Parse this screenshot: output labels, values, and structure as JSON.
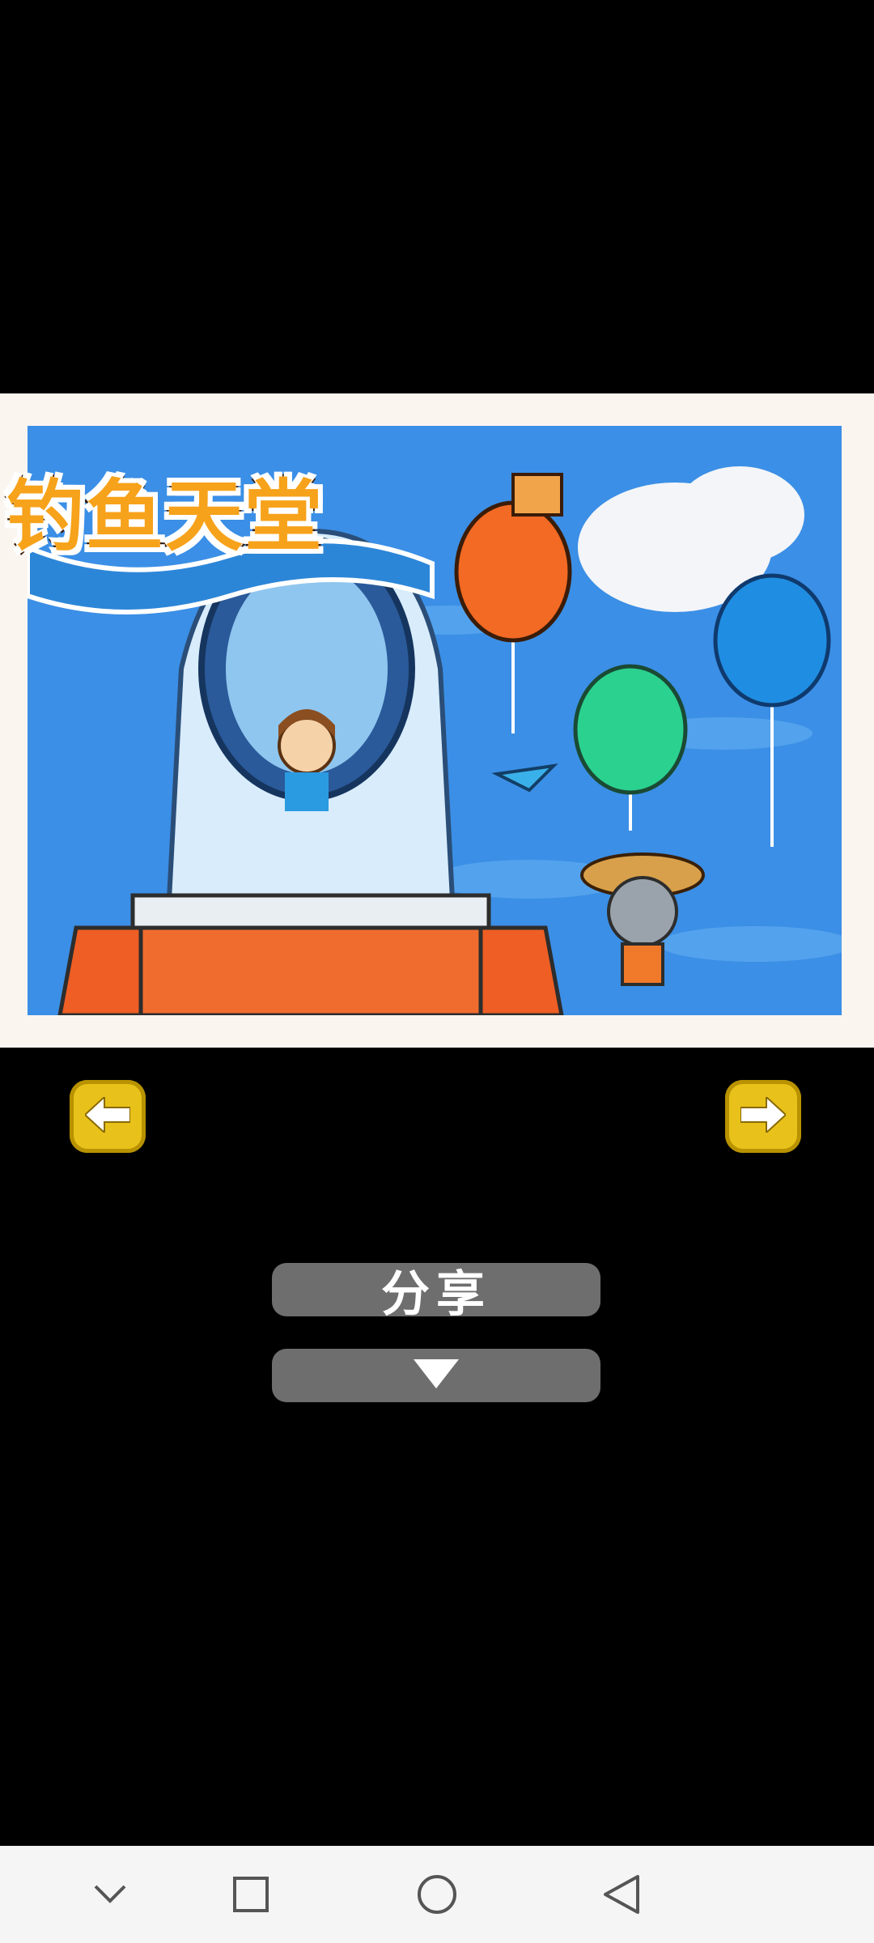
{
  "game": {
    "title_logo": "钓鱼天堂",
    "share_label": "分享"
  },
  "icons": {
    "prev": "arrow-left-icon",
    "next": "arrow-right-icon",
    "expand": "triangle-down-icon",
    "sys_down": "chevron-down-icon",
    "sys_recents": "square-icon",
    "sys_home": "circle-icon",
    "sys_back": "triangle-left-icon"
  },
  "colors": {
    "sky": "#3b8fe6",
    "arrow_button": "#e8c21a",
    "pill": "#6e6e6e",
    "frame": "#fbf5f0"
  }
}
